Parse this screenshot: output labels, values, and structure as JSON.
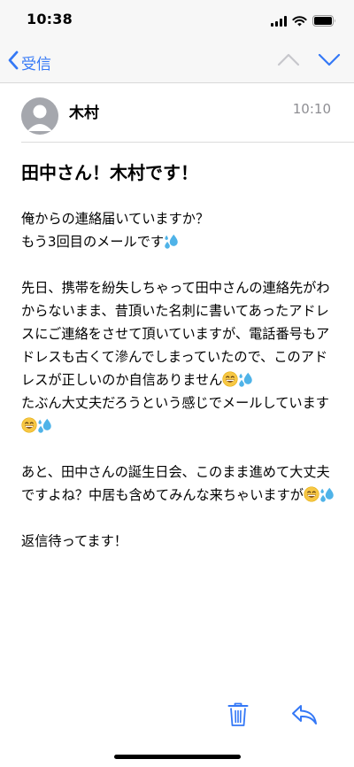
{
  "status_bar": {
    "time": "10:38"
  },
  "nav": {
    "back_label": "受信"
  },
  "message": {
    "sender": "木村",
    "time": "10:10",
    "subject": "田中さん！木村です！",
    "paragraphs": [
      {
        "segments": [
          {
            "text": "俺からの連絡届いていますか？\nもう3回目のメールです"
          },
          {
            "emoji": "sweat-droplets-emoji"
          }
        ]
      },
      {
        "segments": [
          {
            "text": "先日、携帯を紛失しちゃって田中さんの連絡先がわからないまま、昔頂いた名刺に書いてあったアドレスにご連絡をさせて頂いていますが、電話番号もアドレスも古くて滲んでしまっていたので、このアドレスが正しいのか自信ありません"
          },
          {
            "emoji": "grinning-face-emoji"
          },
          {
            "emoji": "sweat-droplets-emoji"
          },
          {
            "text": "\nたぶん大丈夫だろうという感じでメールしています"
          },
          {
            "emoji": "grinning-face-emoji"
          },
          {
            "emoji": "sweat-droplets-emoji"
          }
        ]
      },
      {
        "segments": [
          {
            "text": "あと、田中さんの誕生日会、このまま進めて大丈夫ですよね？中居も含めてみんな来ちゃいますが"
          },
          {
            "emoji": "grinning-face-emoji"
          },
          {
            "emoji": "sweat-droplets-emoji"
          }
        ]
      },
      {
        "segments": [
          {
            "text": "返信待ってます！"
          }
        ]
      }
    ]
  },
  "colors": {
    "accent": "#3478f6",
    "secondary_text": "#8e8e93",
    "avatar_gray": "#a5a7ad"
  }
}
